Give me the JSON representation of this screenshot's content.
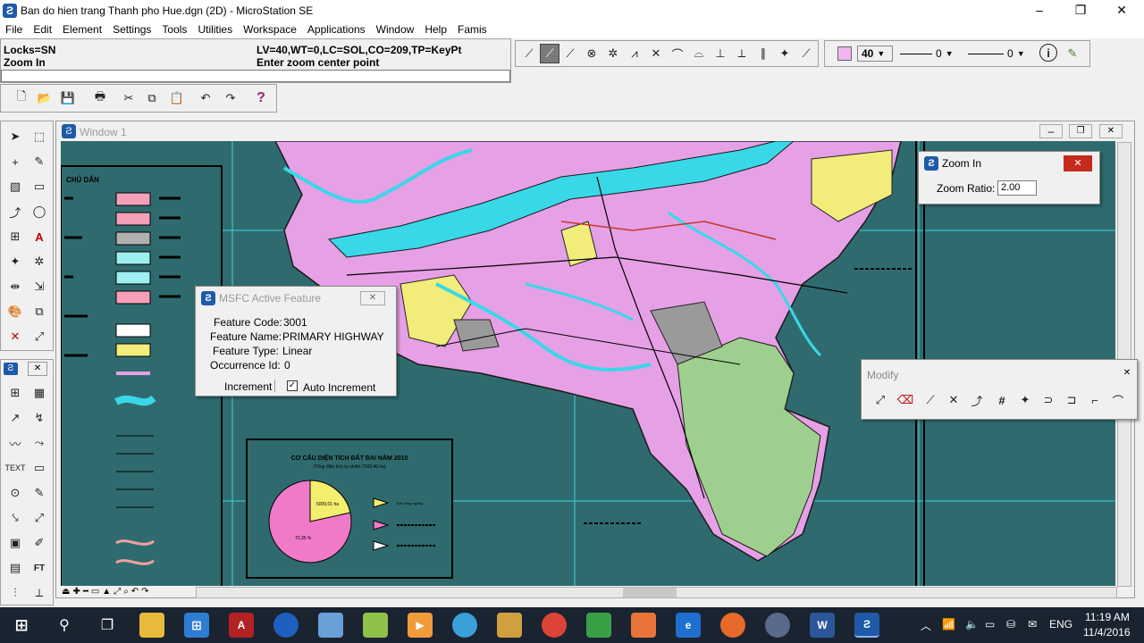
{
  "window": {
    "title": "Ban do hien trang Thanh pho Hue.dgn (2D) - MicroStation SE",
    "minimize": "–",
    "restore": "❐",
    "close": "✕"
  },
  "menu": [
    "File",
    "Edit",
    "Element",
    "Settings",
    "Tools",
    "Utilities",
    "Workspace",
    "Applications",
    "Window",
    "Help",
    "Famis"
  ],
  "status": {
    "locks": "Locks=SN",
    "tool": "Zoom In",
    "symbology": "LV=40,WT=0,LC=SOL,CO=209,TP=KeyPt",
    "prompt": "Enter zoom center point"
  },
  "attributes": {
    "level": "40",
    "line_style": "0",
    "weight": "0",
    "active_color": "#f0b6f0"
  },
  "view_window": {
    "title": "Window 1"
  },
  "zoom_dialog": {
    "title": "Zoom In",
    "ratio_label": "Zoom Ratio:",
    "ratio_value": "2.00"
  },
  "feature_dialog": {
    "title": "MSFC Active Feature",
    "code_label": "Feature Code:",
    "code_value": "3001",
    "name_label": "Feature Name:",
    "name_value": "PRIMARY HIGHWAY",
    "type_label": "Feature Type:",
    "type_value": "Linear",
    "occurrence_label": "Occurrence Id:",
    "occurrence_value": "0",
    "increment_label": "Increment",
    "auto_increment_label": "Auto Increment",
    "auto_increment_checked": true
  },
  "modify_palette": {
    "title": "Modify"
  },
  "map": {
    "legend_title": "CHÚ DẪN",
    "inset_title": "CƠ CẤU DIỆN TÍCH ĐẤT ĐAI NĂM 2010",
    "inset_subtitle": "(Tổng diện tích tự nhiên 7169,46 ha)",
    "pie_label_a": "5009,01 ha",
    "pie_label_b": "70,35 %",
    "legend_item_1": "Đất nông nghiệp",
    "colors": {
      "background": "#2f6b6e",
      "land_pink": "#e6a0e6",
      "water": "#39d8e8",
      "yellow": "#f2ec7a",
      "pie_pink": "#f07ac8",
      "pie_yellow": "#f4ee6e"
    }
  },
  "taskbar": {
    "time": "11:19 AM",
    "date": "11/4/2016",
    "language": "ENG"
  }
}
